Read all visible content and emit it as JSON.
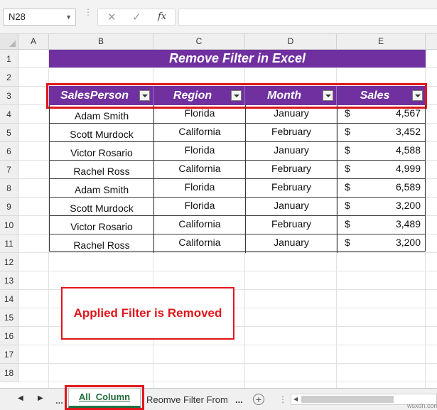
{
  "formula_bar": {
    "name_box": "N28",
    "cancel_glyph": "✕",
    "enter_glyph": "✓",
    "fx_label": "fx",
    "formula_value": ""
  },
  "columns": [
    "A",
    "B",
    "C",
    "D",
    "E"
  ],
  "rows": [
    "1",
    "2",
    "3",
    "4",
    "5",
    "6",
    "7",
    "8",
    "9",
    "10",
    "11",
    "12",
    "13",
    "14",
    "15",
    "16",
    "17",
    "18"
  ],
  "sheet": {
    "title": "Remove Filter in Excel",
    "headers": [
      "SalesPerson",
      "Region",
      "Month",
      "Sales"
    ],
    "data": [
      {
        "salesperson": "Adam Smith",
        "region": "Florida",
        "month": "January",
        "currency": "$",
        "sales": "4,567"
      },
      {
        "salesperson": "Scott Murdock",
        "region": "California",
        "month": "February",
        "currency": "$",
        "sales": "3,452"
      },
      {
        "salesperson": "Victor Rosario",
        "region": "Florida",
        "month": "January",
        "currency": "$",
        "sales": "4,588"
      },
      {
        "salesperson": "Rachel Ross",
        "region": "California",
        "month": "February",
        "currency": "$",
        "sales": "4,999"
      },
      {
        "salesperson": "Adam Smith",
        "region": "Florida",
        "month": "February",
        "currency": "$",
        "sales": "6,589"
      },
      {
        "salesperson": "Scott Murdock",
        "region": "Florida",
        "month": "January",
        "currency": "$",
        "sales": "3,200"
      },
      {
        "salesperson": "Victor Rosario",
        "region": "California",
        "month": "February",
        "currency": "$",
        "sales": "3,489"
      },
      {
        "salesperson": "Rachel Ross",
        "region": "California",
        "month": "January",
        "currency": "$",
        "sales": "3,200"
      }
    ],
    "note": "Applied Filter is Removed"
  },
  "tabs": {
    "more_left": "...",
    "active": "All_Column",
    "second": "Reomve Filter From",
    "more_right": "...",
    "add_glyph": "+"
  },
  "watermark": "wsxdn.com",
  "colors": {
    "header_fill": "#7030a0",
    "highlight": "#e0161b",
    "active_tab": "#1e6b3a"
  }
}
